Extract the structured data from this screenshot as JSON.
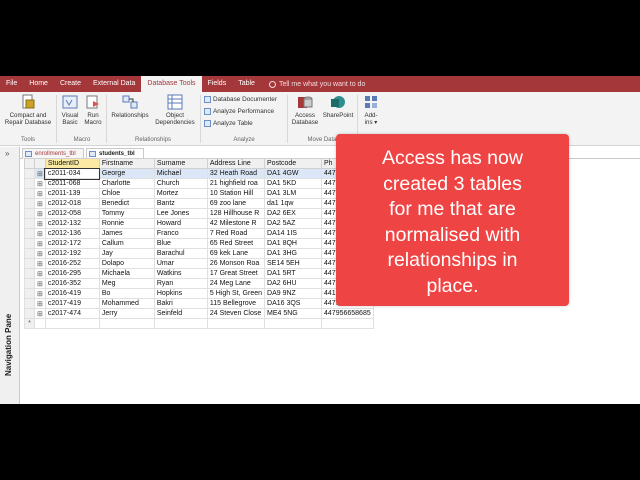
{
  "ribbon_tabs": [
    "File",
    "Home",
    "Create",
    "External Data",
    "Database Tools",
    "Fields",
    "Table"
  ],
  "active_tab": "Database Tools",
  "tell_me": "Tell me what you want to do",
  "ribbon": {
    "tools": {
      "compact_line1": "Compact and",
      "compact_line2": "Repair Database",
      "title": "Tools"
    },
    "macro": {
      "vb_line1": "Visual",
      "vb_line2": "Basic",
      "run_line1": "Run",
      "run_line2": "Macro",
      "title": "Macro"
    },
    "relationships": {
      "rel": "Relationships",
      "obj_line1": "Object",
      "obj_line2": "Dependencies",
      "title": "Relationships"
    },
    "analyze": {
      "documenter": "Database Documenter",
      "performance": "Analyze Performance",
      "table": "Analyze Table",
      "title": "Analyze"
    },
    "move": {
      "access_line1": "Access",
      "access_line2": "Database",
      "sharepoint": "SharePoint",
      "title": "Move Data"
    },
    "addins": {
      "line1": "Add-",
      "line2": "ins ▾"
    }
  },
  "nav_pane": {
    "label": "Navigation Pane",
    "chevron": "»"
  },
  "doc_tabs": [
    "enrollments_tbl",
    "students_tbl"
  ],
  "grid": {
    "headers": [
      "StudentID",
      "Firstname",
      "Surname",
      "Address Line",
      "Postcode",
      "Ph"
    ],
    "rows": [
      [
        "c2011-034",
        "George",
        "Michael",
        "32 Heath Road",
        "DA1 4GW",
        "44791"
      ],
      [
        "c2011-068",
        "Charlotte",
        "Church",
        "21 highfield roa",
        "DA1 5KD",
        "44791"
      ],
      [
        "c2011-139",
        "Chloe",
        "Mortez",
        "10 Station Hill",
        "DA1 3LM",
        "44761"
      ],
      [
        "c2012-018",
        "Benedict",
        "Bantz",
        "69 zoo lane",
        "da1 1qw",
        "44791"
      ],
      [
        "c2012-058",
        "Tommy",
        "Lee Jones",
        "128 Hillhouse R",
        "DA2 6EX",
        "44791"
      ],
      [
        "c2012-132",
        "Ronnie",
        "Howard",
        "42 Milestone R",
        "DA2 5AZ",
        "44791"
      ],
      [
        "c2012-136",
        "James",
        "Franco",
        "7 Red Road",
        "DA14 1IS",
        "44717"
      ],
      [
        "c2012-172",
        "Callum",
        "Blue",
        "65 Red Street",
        "DA1 8QH",
        "44791"
      ],
      [
        "c2012-192",
        "Jay",
        "Barachul",
        "69 kek Lane",
        "DA1 3HG",
        "44789"
      ],
      [
        "c2016-252",
        "Dolapo",
        "Umar",
        "26 Monson Roa",
        "SE14 5EH",
        "44791"
      ],
      [
        "c2016-295",
        "Michaela",
        "Watkins",
        "17 Great Street",
        "DA1 5RT",
        "44791"
      ],
      [
        "c2016-352",
        "Meg",
        "Ryan",
        "24 Meg Lane",
        "DA2 6HU",
        "44798"
      ],
      [
        "c2016-419",
        "Bo",
        "Hopkins",
        "5 High St, Green",
        "DA9 9NZ",
        "441987378851"
      ],
      [
        "c2017-419",
        "Mohammed",
        "Bakri",
        "115 Bellegrove",
        "DA16 3QS",
        "447956356821"
      ],
      [
        "c2017-474",
        "Jerry",
        "Seinfeld",
        "24 Steven Close",
        "ME4 5NG",
        "447956658685"
      ]
    ],
    "new_row_marker": "*"
  },
  "callout": {
    "lines": [
      "Access has now",
      "created 3  tables",
      "for me that are",
      "normalised with",
      "relationships in",
      "place."
    ]
  },
  "colors": {
    "accent": "#a4373a",
    "callout": "#ef4444",
    "selection": "#dbe7f7"
  }
}
